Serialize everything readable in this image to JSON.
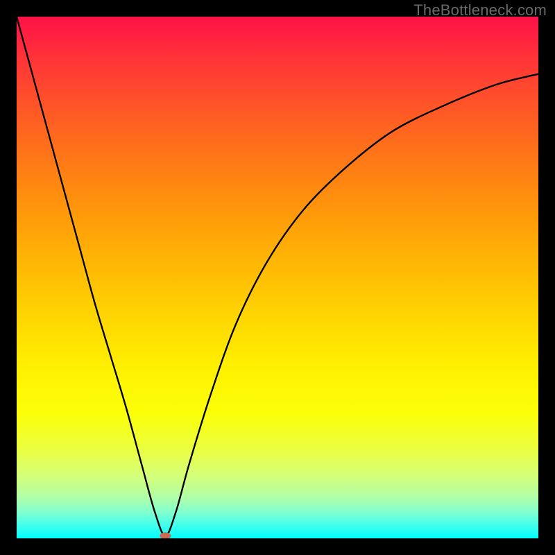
{
  "watermark": {
    "text": "TheBottleneck.com"
  },
  "chart_data": {
    "type": "line",
    "title": "",
    "xlabel": "",
    "ylabel": "",
    "xlim": [
      0,
      100
    ],
    "ylim": [
      0,
      100
    ],
    "grid": false,
    "legend": false,
    "background_gradient": {
      "top": "#ff1149",
      "bottom": "#00fffb",
      "meaning": "high (red) to low (green) bottleneck severity"
    },
    "minimum_point": {
      "x": 28.5,
      "y": 0.5,
      "marker_color": "#c96a57"
    },
    "series": [
      {
        "name": "bottleneck-curve",
        "x": [
          0,
          3,
          6,
          9,
          12,
          15,
          18,
          21,
          24,
          26.5,
          28.5,
          30.5,
          33,
          37,
          42,
          48,
          55,
          63,
          72,
          82,
          92,
          100
        ],
        "values": [
          100,
          89,
          78,
          67,
          56,
          45,
          35,
          25,
          14,
          5,
          0.5,
          5,
          14,
          27,
          41,
          53,
          63,
          71,
          78,
          83,
          87,
          89
        ]
      }
    ]
  }
}
